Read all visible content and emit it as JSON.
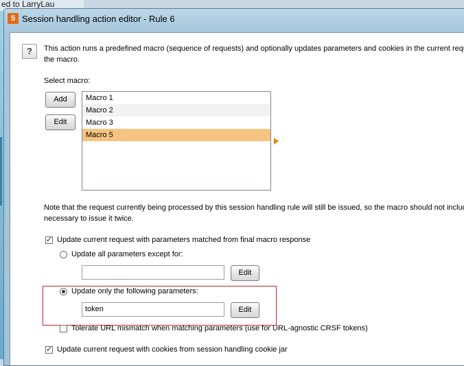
{
  "background": {
    "text": "ed to LarryLau"
  },
  "window": {
    "title": "Session handling action editor - Rule 6",
    "app_icon_glyph": "5"
  },
  "help": {
    "icon_glyph": "?"
  },
  "description": {
    "line1": "This action runs a predefined macro (sequence of requests) and optionally updates parameters and cookies in the current requ",
    "line2": "the macro."
  },
  "macro_section": {
    "label": "Select macro:",
    "add_label": "Add",
    "edit_label": "Edit",
    "items": [
      {
        "label": "Macro 1",
        "selected": false
      },
      {
        "label": "Macro 2",
        "selected": false
      },
      {
        "label": "Macro 3",
        "selected": false
      },
      {
        "label": "Macro 5",
        "selected": true
      }
    ]
  },
  "note": {
    "line1": "Note that the request currently being processed by this session handling rule will still be issued, so the macro should not include",
    "line2": "necessary to issue it twice."
  },
  "update_params": {
    "label": "Update current request with parameters matched from final macro response",
    "checked": true,
    "all_except": {
      "label": "Update all parameters except for:",
      "selected": false,
      "value": "",
      "edit_label": "Edit"
    },
    "only_following": {
      "label": "Update only the following parameters:",
      "selected": true,
      "value": "token",
      "edit_label": "Edit"
    },
    "tolerate": {
      "label": "Tolerate URL mismatch when matching parameters (use for URL-agnostic CRSF tokens)",
      "checked": false
    }
  },
  "update_cookies": {
    "label": "Update current request with cookies from session handling cookie jar",
    "checked": true
  },
  "colors": {
    "selection": "#f6c380",
    "highlight_box": "#c1272d",
    "arrow": "#e8860f"
  }
}
